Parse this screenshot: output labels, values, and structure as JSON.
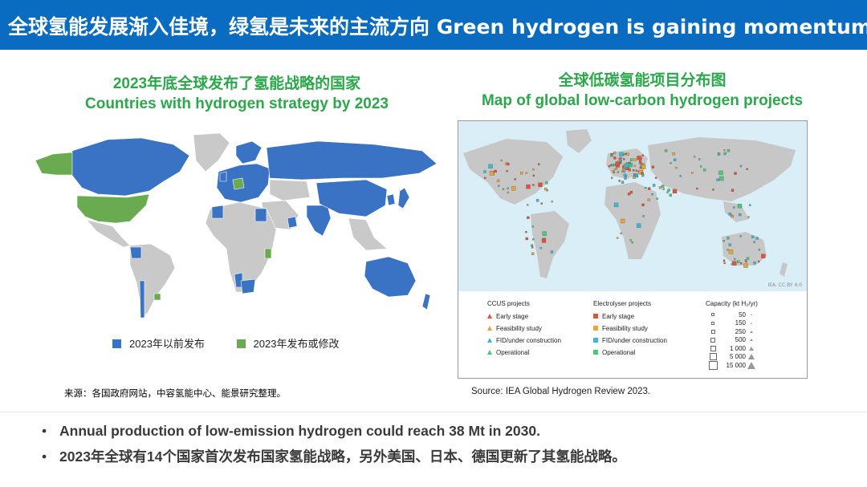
{
  "header": {
    "title": "全球氢能发展渐入佳境，绿氢是未来的主流方向 Green hydrogen is gaining momentum",
    "background": "#0a6cc0"
  },
  "left_panel": {
    "title_cn": "2023年底全球发布了氢能战略的国家",
    "title_en": "Countries with hydrogen strategy by 2023",
    "legend": [
      {
        "label": "2023年以前发布",
        "color": "#3a72c4"
      },
      {
        "label": "2023年发布或修改",
        "color": "#6aaa50"
      }
    ],
    "source": "来源：各国政府网站，中容氢能中心、能景研究整理。"
  },
  "right_panel": {
    "title_cn": "全球低碳氢能项目分布图",
    "title_en": "Map of global low-carbon hydrogen projects",
    "map_credit": "IEA. CC BY 4.0",
    "ccus": {
      "heading": "CCUS projects",
      "items": [
        {
          "label": "Early stage",
          "color": "#e0523a"
        },
        {
          "label": "Feasibility study",
          "color": "#e8a33a"
        },
        {
          "label": "FID/under construction",
          "color": "#3ab8d8"
        },
        {
          "label": "Operational",
          "color": "#4cc87a"
        }
      ]
    },
    "electrolyser": {
      "heading": "Electrolyser projects",
      "items": [
        {
          "label": "Early stage",
          "color": "#e0523a"
        },
        {
          "label": "Feasibility study",
          "color": "#e8a33a"
        },
        {
          "label": "FID/under construction",
          "color": "#3ab8d8"
        },
        {
          "label": "Operational",
          "color": "#4cc87a"
        }
      ]
    },
    "capacity": {
      "heading": "Capacity (kt H₂/yr)",
      "values": [
        "50",
        "150",
        "250",
        "500",
        "1 000",
        "5 000",
        "15 000"
      ]
    },
    "source": "Source: IEA Global Hydrogen Review 2023."
  },
  "bullets": [
    "Annual production of low-emission hydrogen could reach 38 Mt in 2030.",
    "2023年全球有14个国家首次发布国家氢能战略，另外美国、日本、德国更新了其氢能战略。"
  ]
}
